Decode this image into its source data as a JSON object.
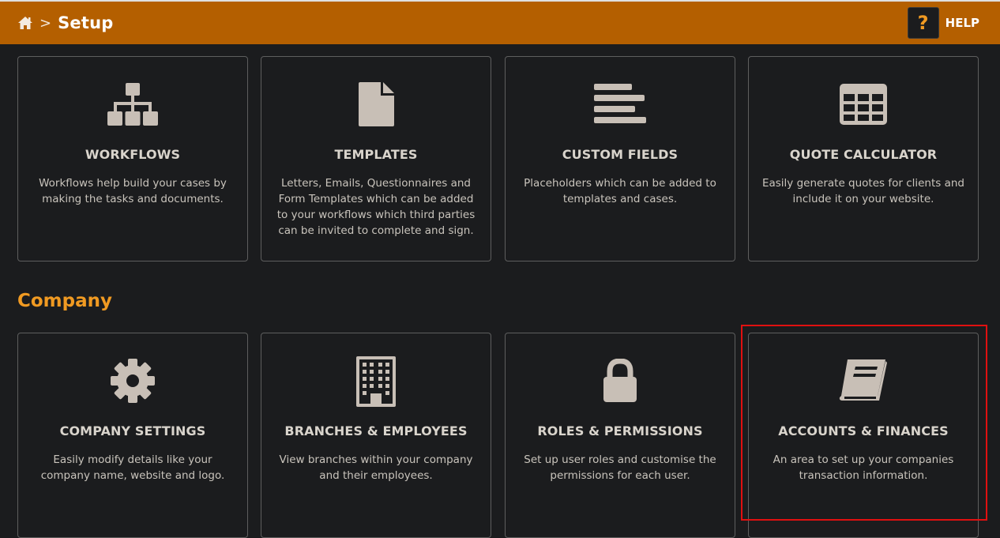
{
  "header": {
    "breadcrumb_separator": ">",
    "title": "Setup",
    "help_icon_glyph": "?",
    "help_label": "HELP"
  },
  "colors": {
    "header_bg": "#b45f00",
    "page_bg": "#1b1c1e",
    "accent": "#f09a22",
    "highlight": "#e01010"
  },
  "top_cards": [
    {
      "icon": "sitemap-icon",
      "title": "WORKFLOWS",
      "description": "Workflows help build your cases by making the tasks and documents."
    },
    {
      "icon": "file-icon",
      "title": "TEMPLATES",
      "description": "Letters, Emails, Questionnaires and Form Templates which can be added to your workflows which third parties can be invited to complete and sign."
    },
    {
      "icon": "align-left-icon",
      "title": "CUSTOM FIELDS",
      "description": "Placeholders which can be added to templates and cases."
    },
    {
      "icon": "table-icon",
      "title": "QUOTE CALCULATOR",
      "description": "Easily generate quotes for clients and include it on your website."
    }
  ],
  "company_section": {
    "title": "Company",
    "cards": [
      {
        "icon": "gear-icon",
        "title": "COMPANY SETTINGS",
        "description": "Easily modify details like your company name, website and logo."
      },
      {
        "icon": "building-icon",
        "title": "BRANCHES & EMPLOYEES",
        "description": "View branches within your company and their employees."
      },
      {
        "icon": "lock-icon",
        "title": "ROLES & PERMISSIONS",
        "description": "Set up user roles and customise the permissions for each user."
      },
      {
        "icon": "book-icon",
        "title": "ACCOUNTS & FINANCES",
        "description": "An area to set up your companies transaction information.",
        "highlighted": true
      }
    ]
  }
}
